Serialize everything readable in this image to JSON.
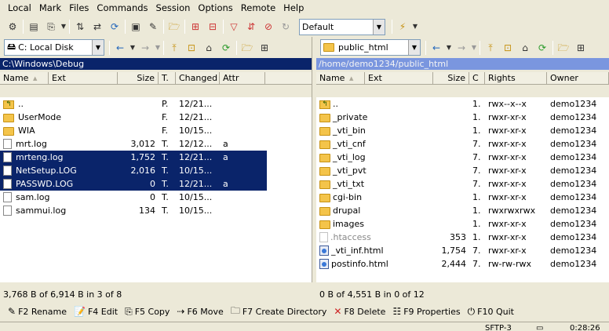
{
  "menu": [
    "Local",
    "Mark",
    "Files",
    "Commands",
    "Session",
    "Options",
    "Remote",
    "Help"
  ],
  "toolbar": {
    "profile": "Default"
  },
  "left": {
    "drive": "C: Local Disk",
    "path": "C:\\Windows\\Debug",
    "headers": {
      "name": "Name",
      "ext": "Ext",
      "size": "Size",
      "type": "T.",
      "changed": "Changed",
      "attr": "Attr"
    },
    "files": [
      {
        "name": "..",
        "size": "",
        "type": "P.",
        "changed": "12/21...",
        "attr": "",
        "icon": "up",
        "selected": false
      },
      {
        "name": "UserMode",
        "size": "",
        "type": "F.",
        "changed": "12/21...",
        "attr": "",
        "icon": "folder",
        "selected": false
      },
      {
        "name": "WIA",
        "size": "",
        "type": "F.",
        "changed": "10/15...",
        "attr": "",
        "icon": "folder",
        "selected": false
      },
      {
        "name": "mrt.log",
        "size": "3,012",
        "type": "T.",
        "changed": "12/12...",
        "attr": "a",
        "icon": "file",
        "selected": false
      },
      {
        "name": "mrteng.log",
        "size": "1,752",
        "type": "T.",
        "changed": "12/21...",
        "attr": "a",
        "icon": "file",
        "selected": true
      },
      {
        "name": "NetSetup.LOG",
        "size": "2,016",
        "type": "T.",
        "changed": "10/15...",
        "attr": "",
        "icon": "file",
        "selected": true
      },
      {
        "name": "PASSWD.LOG",
        "size": "0",
        "type": "T.",
        "changed": "12/21...",
        "attr": "a",
        "icon": "file",
        "selected": true
      },
      {
        "name": "sam.log",
        "size": "0",
        "type": "T.",
        "changed": "10/15...",
        "attr": "",
        "icon": "file",
        "selected": false
      },
      {
        "name": "sammui.log",
        "size": "134",
        "type": "T.",
        "changed": "10/15...",
        "attr": "",
        "icon": "file",
        "selected": false
      }
    ],
    "status": "3,768 B of 6,914 B in 3 of 8"
  },
  "right": {
    "dir": "public_html",
    "path": "/home/demo1234/public_html",
    "headers": {
      "name": "Name",
      "ext": "Ext",
      "size": "Size",
      "c": "C",
      "rights": "Rights",
      "owner": "Owner"
    },
    "files": [
      {
        "name": "..",
        "size": "",
        "c": "1.",
        "rights": "rwx--x--x",
        "owner": "demo1234",
        "icon": "up"
      },
      {
        "name": "_private",
        "size": "",
        "c": "1.",
        "rights": "rwxr-xr-x",
        "owner": "demo1234",
        "icon": "folder"
      },
      {
        "name": "_vti_bin",
        "size": "",
        "c": "1.",
        "rights": "rwxr-xr-x",
        "owner": "demo1234",
        "icon": "folder"
      },
      {
        "name": "_vti_cnf",
        "size": "",
        "c": "7.",
        "rights": "rwxr-xr-x",
        "owner": "demo1234",
        "icon": "folder"
      },
      {
        "name": "_vti_log",
        "size": "",
        "c": "7.",
        "rights": "rwxr-xr-x",
        "owner": "demo1234",
        "icon": "folder"
      },
      {
        "name": "_vti_pvt",
        "size": "",
        "c": "7.",
        "rights": "rwxr-xr-x",
        "owner": "demo1234",
        "icon": "folder"
      },
      {
        "name": "_vti_txt",
        "size": "",
        "c": "7.",
        "rights": "rwxr-xr-x",
        "owner": "demo1234",
        "icon": "folder"
      },
      {
        "name": "cgi-bin",
        "size": "",
        "c": "1.",
        "rights": "rwxr-xr-x",
        "owner": "demo1234",
        "icon": "folder"
      },
      {
        "name": "drupal",
        "size": "",
        "c": "1.",
        "rights": "rwxrwxrwx",
        "owner": "demo1234",
        "icon": "folder"
      },
      {
        "name": "images",
        "size": "",
        "c": "1.",
        "rights": "rwxr-xr-x",
        "owner": "demo1234",
        "icon": "folder"
      },
      {
        "name": ".htaccess",
        "size": "353",
        "c": "1.",
        "rights": "rwxr-xr-x",
        "owner": "demo1234",
        "icon": "file",
        "hidden": true
      },
      {
        "name": "_vti_inf.html",
        "size": "1,754",
        "c": "7.",
        "rights": "rwxr-xr-x",
        "owner": "demo1234",
        "icon": "html"
      },
      {
        "name": "postinfo.html",
        "size": "2,444",
        "c": "7.",
        "rights": "rw-rw-rwx",
        "owner": "demo1234",
        "icon": "html"
      }
    ],
    "status": "0 B of 4,551 B in 0 of 12"
  },
  "fkeys": [
    {
      "label": "F2 Rename",
      "icon": "rename-icon",
      "glyph": "✎"
    },
    {
      "label": "F4 Edit",
      "icon": "edit-icon",
      "glyph": "📝"
    },
    {
      "label": "F5 Copy",
      "icon": "copy-icon",
      "glyph": "⎘"
    },
    {
      "label": "F6 Move",
      "icon": "move-icon",
      "glyph": "⇢"
    },
    {
      "label": "F7 Create Directory",
      "icon": "new-folder-icon",
      "glyph": "🗀"
    },
    {
      "label": "F8 Delete",
      "icon": "delete-icon",
      "glyph": "✕"
    },
    {
      "label": "F9 Properties",
      "icon": "properties-icon",
      "glyph": "☷"
    },
    {
      "label": "F10 Quit",
      "icon": "quit-icon",
      "glyph": "⏻"
    }
  ],
  "bottom": {
    "mode": "SFTP-3",
    "time": "0:28:26"
  },
  "colors": {
    "selection": "#0a246a",
    "delete": "#cc2222"
  }
}
